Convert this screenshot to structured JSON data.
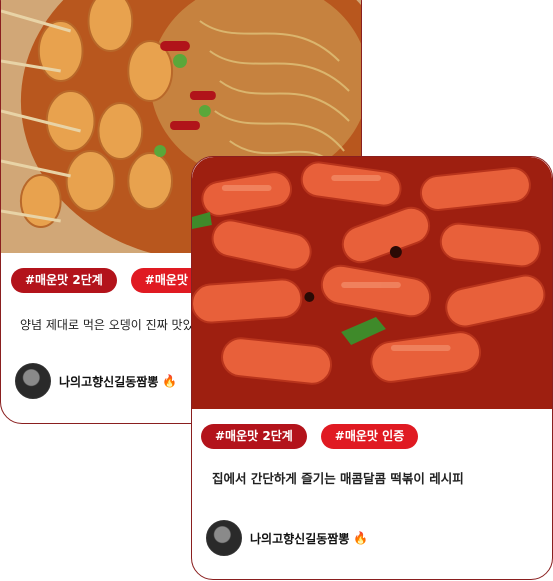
{
  "cards": [
    {
      "tags": [
        "#매운맛 2단계",
        "#매운맛 인증"
      ],
      "description": "양념 제대로 먹은 오뎅이 진짜 맛있었어요 은근히 는 매운🌶️",
      "author": "나의고향신길동짬뽕",
      "author_emoji": "🔥"
    },
    {
      "tags": [
        "#매운맛 2단계",
        "#매운맛 인증"
      ],
      "description": "집에서 간단하게 즐기는 매콤달콤 떡볶이 레시피",
      "author": "나의고향신길동짬뽕",
      "author_emoji": "🔥"
    }
  ],
  "colors": {
    "tag_dark": "#b3131b",
    "tag_bright": "#e01a22",
    "border": "#8a1f1f"
  }
}
